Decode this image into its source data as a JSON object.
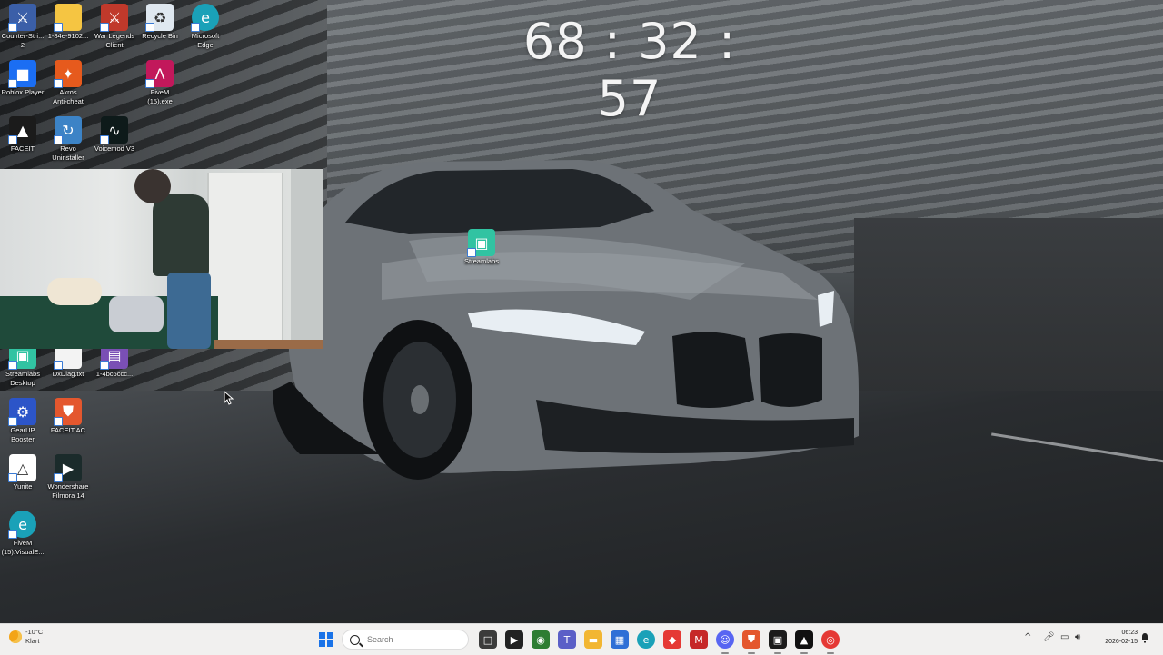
{
  "clock": {
    "text": "68 : 32 : 57"
  },
  "desktop_icons": [
    {
      "label": "Counter-Stri...\n2",
      "icon": "counter-strike-icon",
      "color": "#3b5fa8"
    },
    {
      "label": "1-84e-9102...",
      "icon": "folder-icon",
      "color": "#f5c542"
    },
    {
      "label": "War Legends\nClient",
      "icon": "war-legends-icon",
      "color": "#c0392b"
    },
    {
      "label": "Recycle Bin",
      "icon": "recycle-bin-icon",
      "color": "#dfe8f0"
    },
    {
      "label": "Microsoft\nEdge",
      "icon": "edge-icon",
      "color": "#1aa1b8"
    },
    {
      "label": "Roblox Player",
      "icon": "roblox-icon",
      "color": "#1b6ef3"
    },
    {
      "label": "Akros\nAnti-cheat",
      "icon": "akros-icon",
      "color": "#e65a1d"
    },
    {
      "label": "FiveM\n(15).exe",
      "icon": "fivem-icon",
      "color": "#c2185b"
    },
    {
      "label": "FACEIT",
      "icon": "faceit-icon",
      "color": "#1b1b1b"
    },
    {
      "label": "Revo\nUninstaller",
      "icon": "revo-uninstaller-icon",
      "color": "#3c83c6"
    },
    {
      "label": "Voicemod V3",
      "icon": "voicemod-icon",
      "color": "#0e1a1a"
    },
    {
      "label": "Streamlabs",
      "icon": "streamlabs-icon",
      "color": "#31c3a2"
    },
    {
      "label": "Streamlabs\nDesktop",
      "icon": "streamlabs-desktop-icon",
      "color": "#31c3a2"
    },
    {
      "label": "DxDiag.txt",
      "icon": "text-file-icon",
      "color": "#f3f3f3"
    },
    {
      "label": "1-4bc6ccc...",
      "icon": "archive-icon",
      "color": "#7a4fb5"
    },
    {
      "label": "GearUP\nBooster",
      "icon": "gearup-icon",
      "color": "#2c55c8"
    },
    {
      "label": "FACEIT AC",
      "icon": "faceit-ac-icon",
      "color": "#e4572e"
    },
    {
      "label": "Yunite",
      "icon": "yunite-icon",
      "color": "#ffffff"
    },
    {
      "label": "Wondershare\nFilmora 14",
      "icon": "filmora-icon",
      "color": "#1b2b2b"
    },
    {
      "label": "FiveM\n(15).VisualE...",
      "icon": "edge-file-icon",
      "color": "#1aa1b8"
    }
  ],
  "taskbar": {
    "weather_temp": "-10°C",
    "weather_desc": "Klart",
    "search_placeholder": "Search",
    "apps": [
      {
        "name": "file-viewer-icon",
        "color": "#3b3b3b"
      },
      {
        "name": "media-app-icon",
        "color": "#222222"
      },
      {
        "name": "nvidia-icon",
        "color": "#2e7d32"
      },
      {
        "name": "teams-icon",
        "color": "#5b5fc7"
      },
      {
        "name": "file-explorer-icon",
        "color": "#f2b632"
      },
      {
        "name": "store-icon",
        "color": "#2f6fd6"
      },
      {
        "name": "edge-icon",
        "color": "#1aa1b8"
      },
      {
        "name": "red-diamond-app-icon",
        "color": "#e53935"
      },
      {
        "name": "mcafee-icon",
        "color": "#c62828"
      },
      {
        "name": "discord-icon",
        "color": "#5865f2"
      },
      {
        "name": "faceit-ac-icon",
        "color": "#e4572e"
      },
      {
        "name": "streamlabs-icon",
        "color": "#1b1b1b"
      },
      {
        "name": "faceit-icon",
        "color": "#111111"
      },
      {
        "name": "chrome-icon",
        "color": "#e53935"
      }
    ],
    "time": "06:23",
    "date": "2026-02-15"
  }
}
